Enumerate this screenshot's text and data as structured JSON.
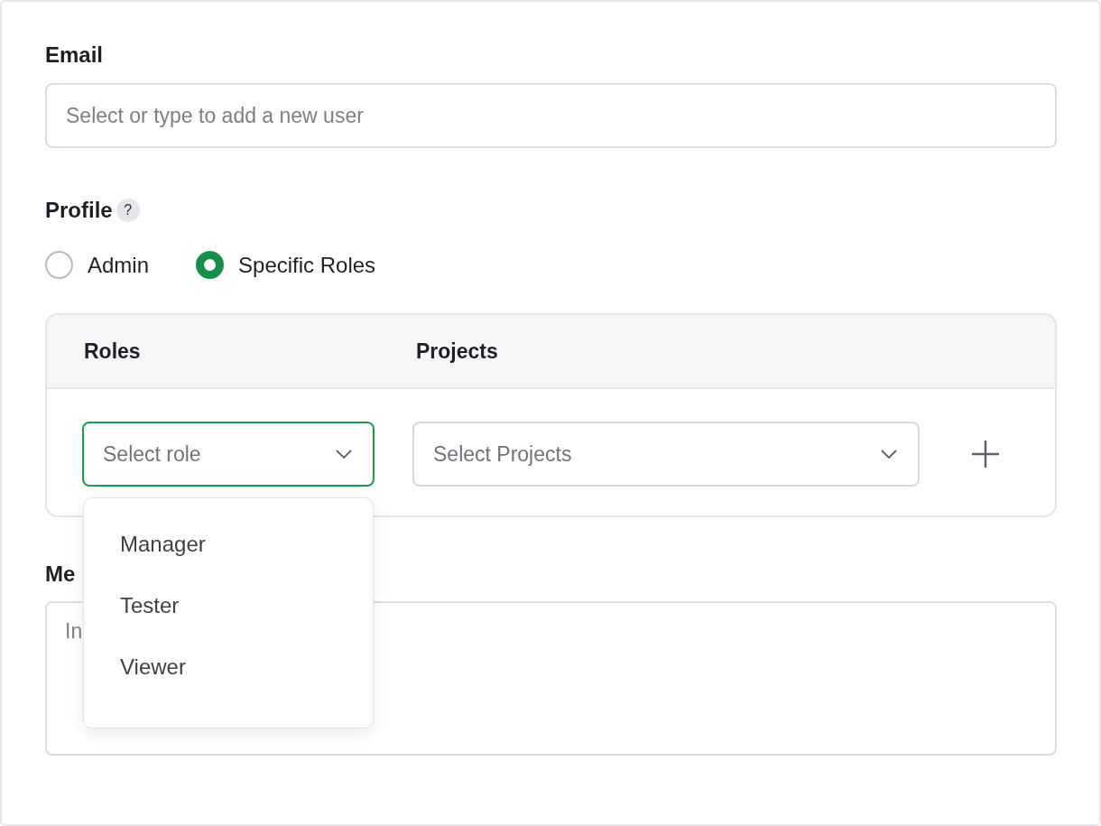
{
  "email": {
    "label": "Email",
    "placeholder": "Select or type to add a new user"
  },
  "profile": {
    "label": "Profile",
    "help": "?",
    "options": [
      {
        "label": "Admin",
        "selected": false
      },
      {
        "label": "Specific Roles",
        "selected": true
      }
    ]
  },
  "roles_table": {
    "columns": [
      "Roles",
      "Projects"
    ],
    "rows": [
      {
        "role": {
          "placeholder": "Select role",
          "focused": true,
          "expanded": true
        },
        "projects": {
          "placeholder": "Select Projects"
        }
      }
    ],
    "role_options": [
      "Manager",
      "Tester",
      "Viewer"
    ]
  },
  "message": {
    "label": "Me",
    "placeholder": "In"
  }
}
